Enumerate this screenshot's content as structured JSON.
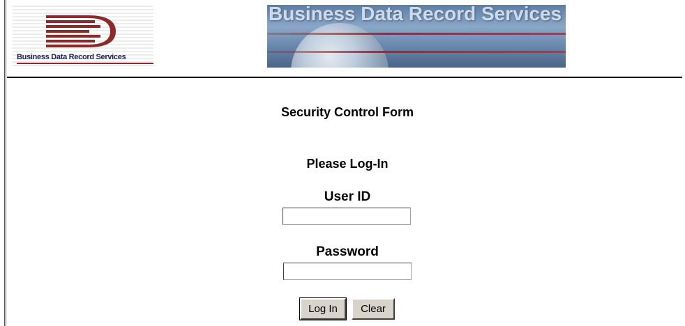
{
  "header": {
    "logo_text": "Business Data Record Services",
    "banner_text": "Business Data Record Services"
  },
  "form": {
    "title": "Security Control Form",
    "login_heading": "Please Log-In",
    "user_id_label": "User ID",
    "user_id_value": "",
    "password_label": "Password",
    "password_value": "",
    "login_button": "Log In",
    "clear_button": "Clear"
  },
  "colors": {
    "logo_red": "#8a2a2a",
    "logo_text": "#1a2255",
    "banner_stripe": "#b3202a"
  }
}
